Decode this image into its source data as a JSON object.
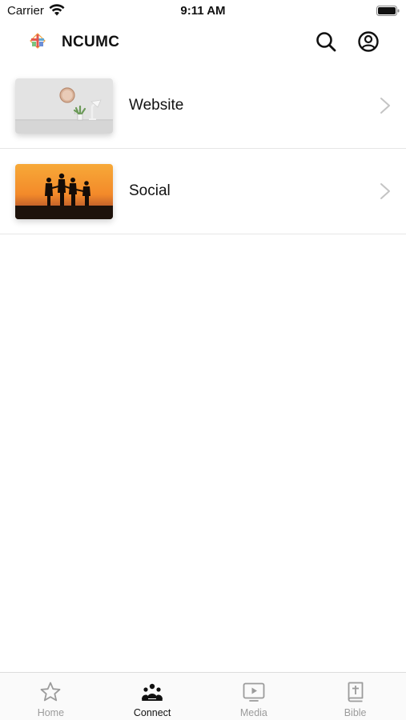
{
  "status_bar": {
    "carrier": "Carrier",
    "time": "9:11 AM"
  },
  "header": {
    "title": "NCUMC",
    "search_icon": "search-icon",
    "account_icon": "account-icon"
  },
  "list": {
    "items": [
      {
        "label": "Website",
        "thumbnail": "wall-clock-and-plant-image"
      },
      {
        "label": "Social",
        "thumbnail": "sunset-silhouette-family-image"
      }
    ]
  },
  "tab_bar": {
    "active": "Connect",
    "tabs": [
      {
        "label": "Home",
        "icon": "star-icon"
      },
      {
        "label": "Connect",
        "icon": "people-icon"
      },
      {
        "label": "Media",
        "icon": "play-screen-icon"
      },
      {
        "label": "Bible",
        "icon": "bible-cross-icon"
      }
    ]
  },
  "colors": {
    "active_tab": "#111111",
    "inactive_tab": "#9b9b9b",
    "divider": "#e6e6e6"
  }
}
